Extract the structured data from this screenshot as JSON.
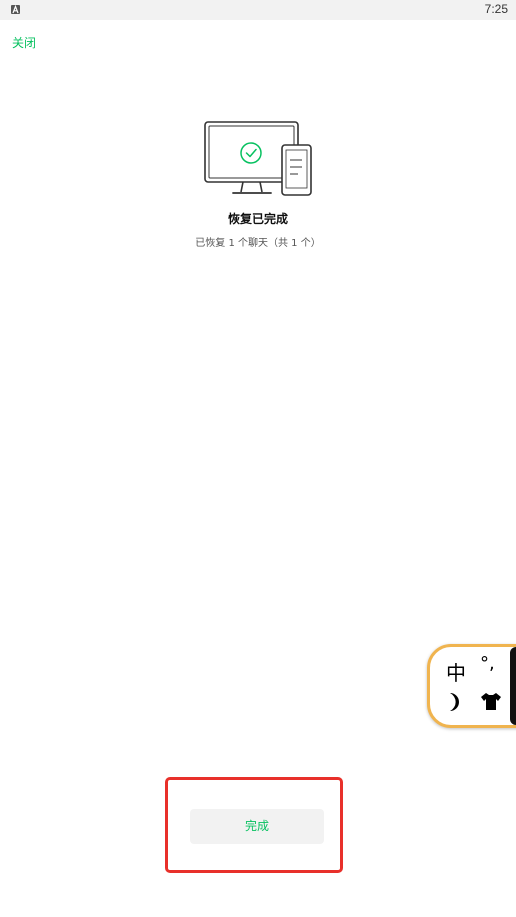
{
  "status_bar": {
    "time": "7:25",
    "app_icon": "a-icon"
  },
  "header": {
    "close_label": "关闭"
  },
  "result": {
    "illustration": "monitor-phone-check-icon",
    "title": "恢复已完成",
    "subtitle": "已恢复 1 个聊天（共 1 个）"
  },
  "ime_widget": {
    "char": "中",
    "punct": "°,",
    "icons": [
      "moon-icon",
      "shirt-icon"
    ]
  },
  "footer": {
    "done_label": "完成"
  },
  "colors": {
    "accent": "#07c160",
    "highlight": "#e8302a",
    "ime_border": "#f0b44f"
  }
}
